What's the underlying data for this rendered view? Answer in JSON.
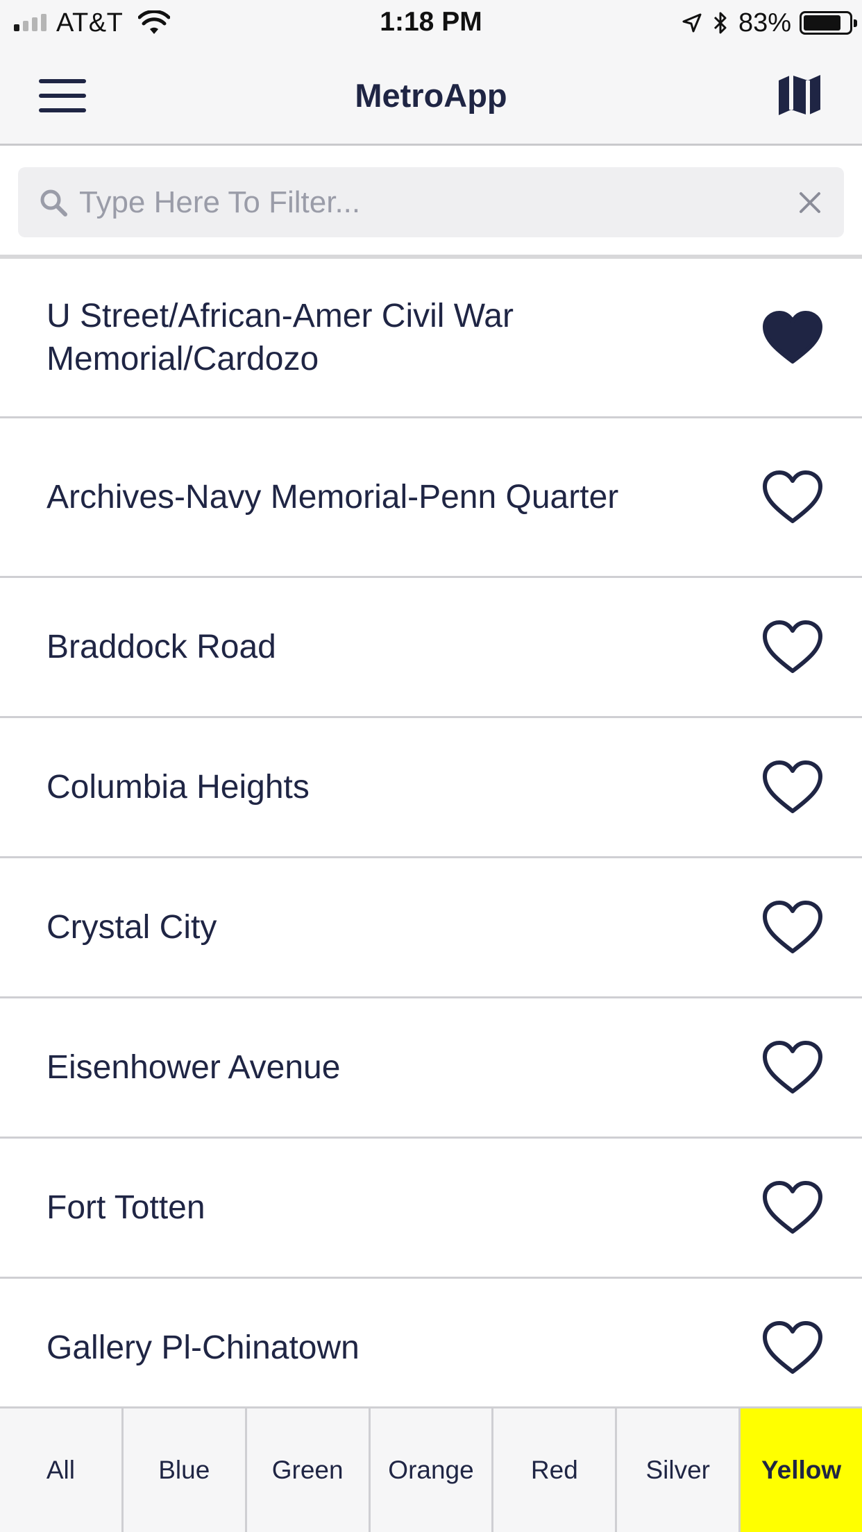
{
  "status_bar": {
    "carrier": "AT&T",
    "time": "1:18 PM",
    "battery_percent": "83%",
    "battery_level": 0.83,
    "signal_bars": 4,
    "signal_bars_active": 1
  },
  "nav": {
    "title": "MetroApp",
    "left_icon": "menu-icon",
    "right_icon": "map-icon"
  },
  "search": {
    "placeholder": "Type Here To Filter...",
    "value": ""
  },
  "colors": {
    "primary": "#1f2544",
    "active_tab": "#ffff00"
  },
  "stations": [
    {
      "name": "U Street/African-Amer Civil War Memorial/Cardozo",
      "favorite": true
    },
    {
      "name": "Archives-Navy Memorial-Penn Quarter",
      "favorite": false
    },
    {
      "name": "Braddock Road",
      "favorite": false
    },
    {
      "name": "Columbia Heights",
      "favorite": false
    },
    {
      "name": "Crystal City",
      "favorite": false
    },
    {
      "name": "Eisenhower Avenue",
      "favorite": false
    },
    {
      "name": "Fort Totten",
      "favorite": false
    },
    {
      "name": "Gallery Pl-Chinatown",
      "favorite": false
    }
  ],
  "tabs": [
    {
      "label": "All",
      "active": false
    },
    {
      "label": "Blue",
      "active": false
    },
    {
      "label": "Green",
      "active": false
    },
    {
      "label": "Orange",
      "active": false
    },
    {
      "label": "Red",
      "active": false
    },
    {
      "label": "Silver",
      "active": false
    },
    {
      "label": "Yellow",
      "active": true
    }
  ]
}
